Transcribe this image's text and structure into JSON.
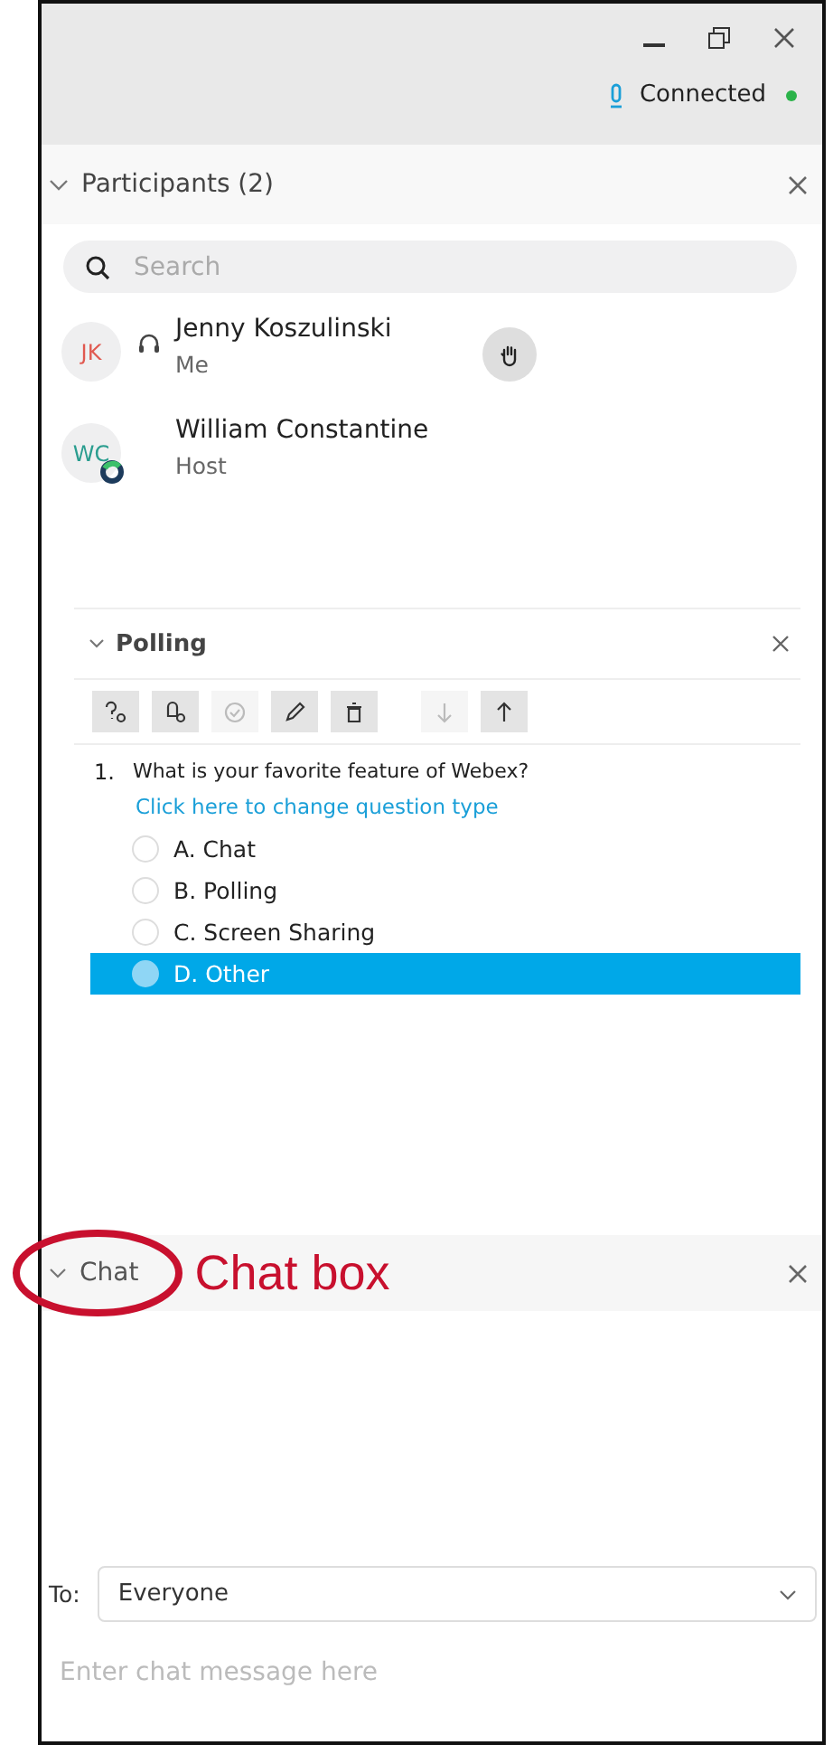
{
  "status": {
    "text": "Connected",
    "connected": true
  },
  "participants": {
    "title": "Participants (2)",
    "search": {
      "placeholder": "Search"
    },
    "people": [
      {
        "initials": "JK",
        "color": "#e0584f",
        "name": "Jenny Koszulinski",
        "role": "Me",
        "headset": true,
        "raised_hand": true,
        "host_badge": false
      },
      {
        "initials": "WC",
        "color": "#2a9d8f",
        "name": "William Constantine",
        "role": "Host",
        "headset": false,
        "raised_hand": false,
        "host_badge": true
      }
    ]
  },
  "polling": {
    "title": "Polling",
    "tools": [
      {
        "kind": "question",
        "disabled": false
      },
      {
        "kind": "answer",
        "disabled": false
      },
      {
        "kind": "check",
        "disabled": true
      },
      {
        "kind": "edit",
        "disabled": false
      },
      {
        "kind": "delete",
        "disabled": false
      },
      {
        "kind": "down",
        "disabled": true
      },
      {
        "kind": "up",
        "disabled": false
      }
    ],
    "question": {
      "number": "1.",
      "text": "What is your favorite feature of Webex?",
      "link": "Click here to change question type",
      "options": [
        {
          "label": "A. Chat",
          "selected": false
        },
        {
          "label": "B. Polling",
          "selected": false
        },
        {
          "label": "C. Screen Sharing",
          "selected": false
        },
        {
          "label": "D. Other",
          "selected": true
        }
      ]
    }
  },
  "chat": {
    "title": "Chat",
    "annotation": "Chat box",
    "to_label": "To:",
    "recipient": "Everyone",
    "placeholder": "Enter chat message here"
  }
}
